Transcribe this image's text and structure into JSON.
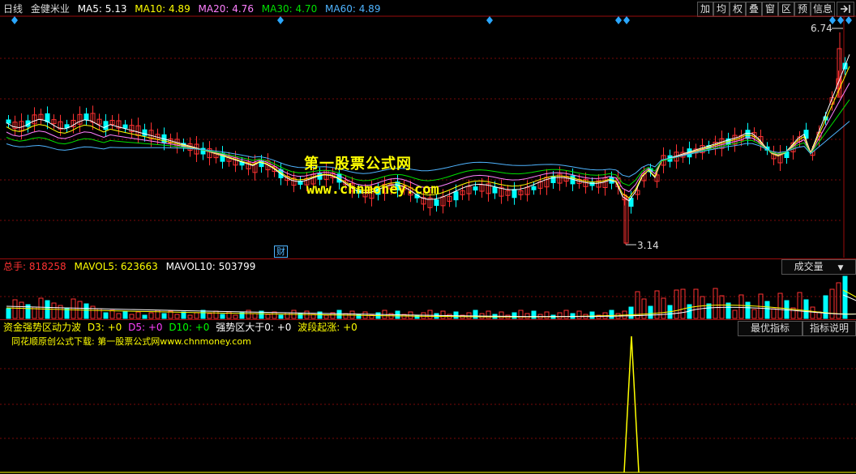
{
  "price_header": {
    "period": "日线",
    "stock_name": "金健米业",
    "ma5": "MA5: 5.13",
    "ma10": "MA10: 4.89",
    "ma20": "MA20: 4.76",
    "ma30": "MA30: 4.70",
    "ma60": "MA60: 4.89"
  },
  "toolbar": {
    "buttons": [
      "加",
      "均",
      "权",
      "叠",
      "窗",
      "区",
      "预",
      "信息"
    ]
  },
  "price_chart": {
    "high_label": "6.74",
    "low_label": "3.14",
    "event_label": "财",
    "watermark_title": "第一股票公式网",
    "watermark_url": "www.chnmoney.com"
  },
  "volume_header": {
    "total": "总手: 818258",
    "mavol5": "MAVOL5: 623663",
    "mavol10": "MAVOL10: 503799",
    "selector": "成交量"
  },
  "indicator_header": {
    "name": "资金强势区动力波",
    "d3": "D3: +0",
    "d5": "D5: +0",
    "d10": "D10: +0",
    "strong": "强势区大于0: +0",
    "wave": "波段起涨: +0",
    "best_button": "最优指标",
    "help_button": "指标说明",
    "note": "同花顺原创公式下载: 第一股票公式网www.chnmoney.com"
  },
  "colors": {
    "up": "#ff3232",
    "down": "#00ffff",
    "ma5": "#ffffff",
    "ma10": "#ffff00",
    "ma20": "#ff80ff",
    "ma30": "#00e000",
    "ma60": "#4fb4ff",
    "grid": "#7a0a0a"
  }
}
